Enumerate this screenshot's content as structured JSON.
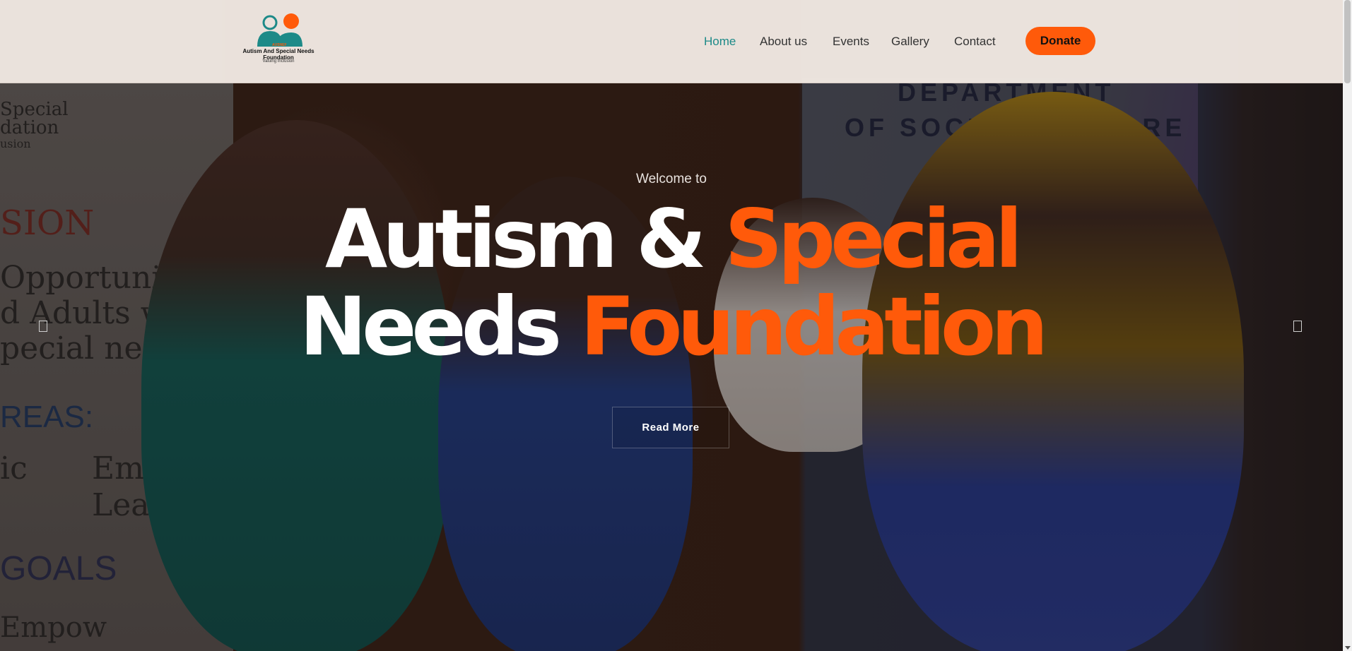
{
  "header": {
    "logo": {
      "name": "Autism And Special Needs Foundation",
      "tagline": "Valuing Inclusion",
      "teal": "#1d8a88",
      "orange": "#ff5a0a"
    },
    "nav": [
      {
        "label": "Home",
        "active": true
      },
      {
        "label": "About us"
      },
      {
        "label": "Events"
      },
      {
        "label": "Gallery"
      },
      {
        "label": "Contact"
      }
    ],
    "donate_label": "Donate"
  },
  "hero": {
    "welcome": "Welcome to",
    "title_line1": {
      "white": "Autism & ",
      "orange": "Special"
    },
    "title_line2": {
      "white": "Needs ",
      "orange": "Foundation"
    },
    "read_more_label": "Read More",
    "prev_icon": "prev-arrow-icon",
    "next_icon": "next-arrow-icon"
  },
  "background_photo": {
    "left_banner_lines": [
      "Special",
      "dation",
      "usion",
      "SION",
      "Opportunities",
      "d Adults with",
      "pecial needs",
      "REAS:",
      "ic",
      "Emo",
      "Lear",
      "GOALS",
      "Empow"
    ],
    "right_banner_lines": [
      "DEPARTMENT",
      "OF SOCIAL WELFARE"
    ]
  },
  "colors": {
    "accent_orange": "#ff5a0a",
    "accent_teal": "#1d8a88",
    "header_bg": "#f1e8e2"
  }
}
